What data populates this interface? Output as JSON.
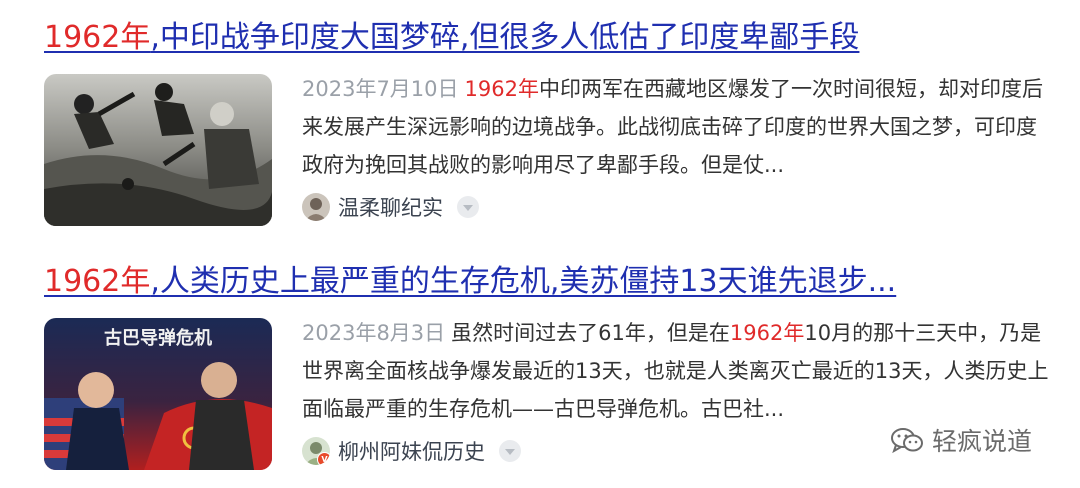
{
  "results": [
    {
      "title_highlight": "1962年",
      "title_rest": ",中印战争印度大国梦碎,但很多人低估了印度卑鄙手段",
      "date": "2023年7月10日",
      "snippet_highlight": "1962年",
      "snippet_rest": "中印两军在西藏地区爆发了一次时间很短，却对印度后来发展产生深远影响的边境战争。此战彻底击碎了印度的世界大国之梦，可印度政府为挽回其战败的影响用尽了卑鄙手段。但是仗...",
      "source": "温柔聊纪实",
      "thumbnail_icon": "war-photo-thumbnail"
    },
    {
      "title_highlight": "1962年",
      "title_rest": ",人类历史上最严重的生存危机,美苏僵持13天谁先退步...",
      "date": "2023年8月3日",
      "snippet_before": "虽然时间过去了61年，但是在",
      "snippet_highlight": "1962年",
      "snippet_after": "10月的那十三天中，乃是世界离全面核战争爆发最近的13天，也就是人类离灭亡最近的13天，人类历史上面临最严重的生存危机——古巴导弹危机。古巴社...",
      "source": "柳州阿妹侃历史",
      "source_badge": "V",
      "thumbnail_text": "古巴导弹危机",
      "thumbnail_icon": "cuban-missile-crisis-poster"
    }
  ],
  "watermark": "轻疯说道",
  "colors": {
    "link": "#1f2fb0",
    "highlight": "#e02a2a",
    "date": "#9aa0a8"
  }
}
